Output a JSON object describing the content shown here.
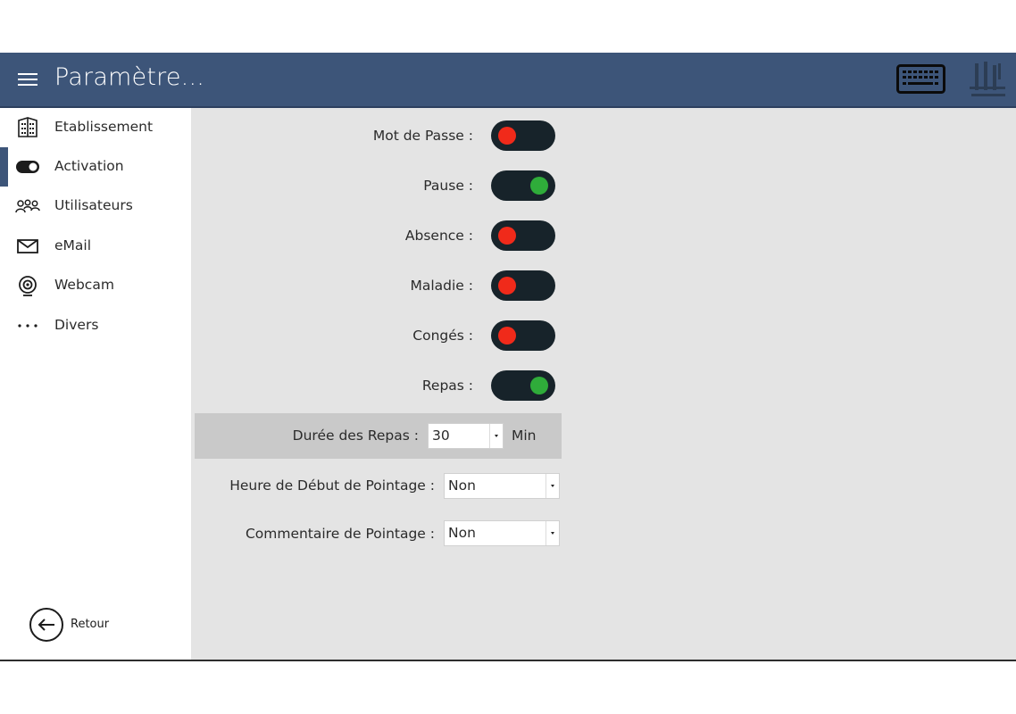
{
  "header": {
    "title": "Paramètre...",
    "menu_icon": "hamburger-icon",
    "keyboard_icon": "keyboard-icon",
    "logo_icon": "app-logo",
    "bg_color": "#3d5579"
  },
  "sidebar": {
    "items": [
      {
        "label": "Etablissement",
        "icon": "building-icon",
        "active": false
      },
      {
        "label": "Activation",
        "icon": "toggle-icon",
        "active": true
      },
      {
        "label": "Utilisateurs",
        "icon": "users-icon",
        "active": false
      },
      {
        "label": "eMail",
        "icon": "mail-icon",
        "active": false
      },
      {
        "label": "Webcam",
        "icon": "webcam-icon",
        "active": false
      },
      {
        "label": "Divers",
        "icon": "more-icon",
        "active": false
      }
    ],
    "back_label": "Retour"
  },
  "settings": {
    "toggles": [
      {
        "label": "Mot de Passe :",
        "on": false
      },
      {
        "label": "Pause :",
        "on": true
      },
      {
        "label": "Absence :",
        "on": false
      },
      {
        "label": "Maladie :",
        "on": false
      },
      {
        "label": "Congés :",
        "on": false
      },
      {
        "label": "Repas :",
        "on": true
      }
    ],
    "duree_repas": {
      "label": "Durée des Repas :",
      "value": "30",
      "unit": "Min"
    },
    "heure_debut": {
      "label": "Heure de Début de Pointage :",
      "value": "Non"
    },
    "commentaire": {
      "label": "Commentaire de Pointage :",
      "value": "Non"
    }
  },
  "colors": {
    "on": "#2fac3a",
    "off": "#f02a1a",
    "toggle_bg": "#17232a"
  }
}
